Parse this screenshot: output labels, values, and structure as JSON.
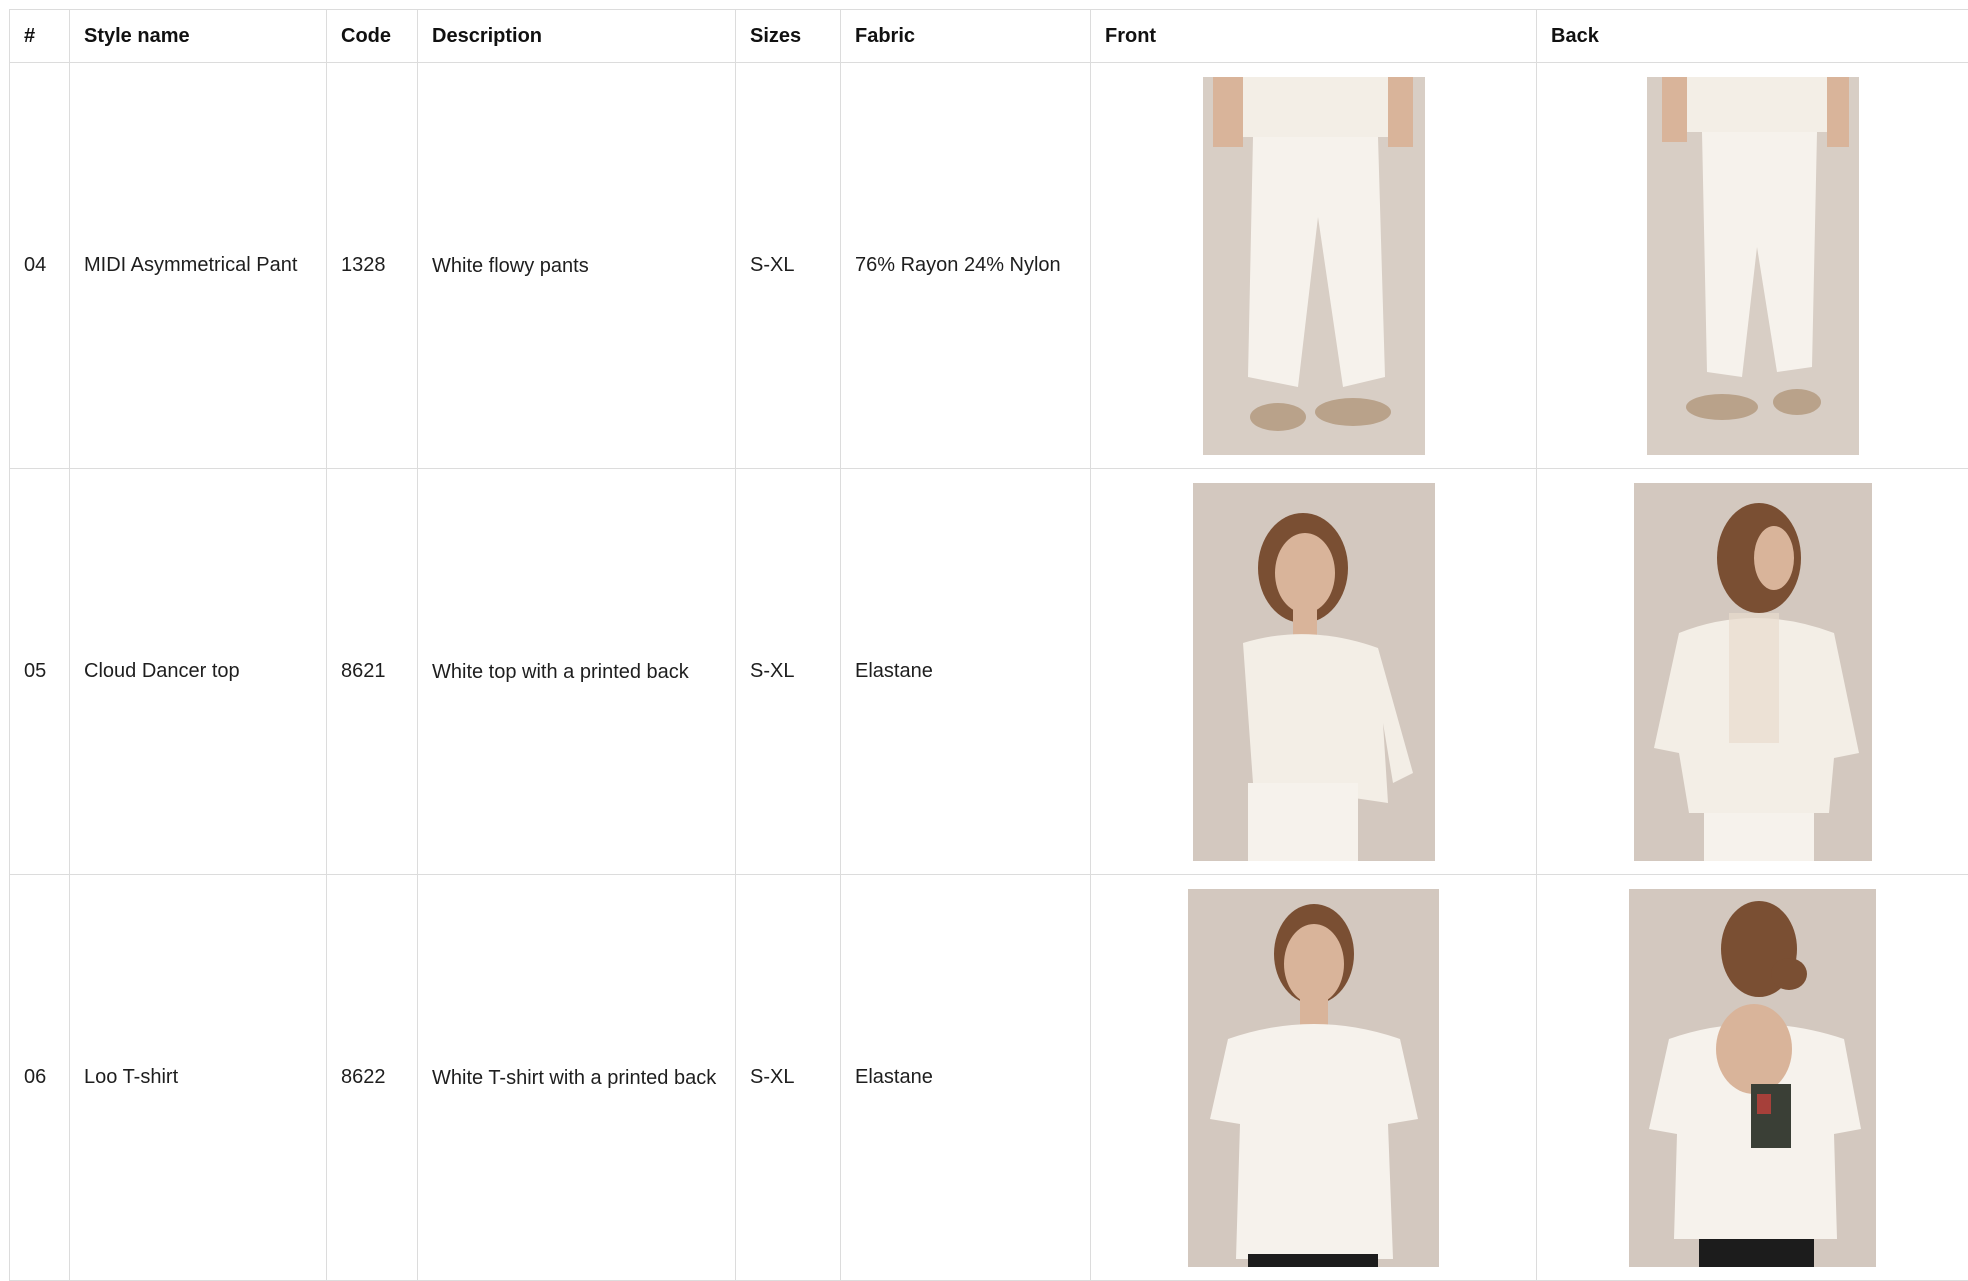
{
  "table": {
    "headers": {
      "num": "#",
      "style": "Style name",
      "code": "Code",
      "desc": "Description",
      "sizes": "Sizes",
      "fabric": "Fabric",
      "front": "Front",
      "back": "Back"
    },
    "rows": [
      {
        "num": "04",
        "style": "MIDI Asymmetrical Pant",
        "code": "1328",
        "desc": "White flowy pants",
        "sizes": "S-XL",
        "fabric": "76% Rayon 24% Nylon",
        "front_image": "model-front-white-pants-photo",
        "back_image": "model-back-white-pants-photo"
      },
      {
        "num": "05",
        "style": "Cloud Dancer top",
        "code": "8621",
        "desc": "White top with a printed back",
        "sizes": "S-XL",
        "fabric": "Elastane",
        "front_image": "model-front-white-top-photo",
        "back_image": "model-back-white-top-printed-photo"
      },
      {
        "num": "06",
        "style": "Loo T-shirt",
        "code": "8622",
        "desc": "White T-shirt with a printed back",
        "sizes": "S-XL",
        "fabric": "Elastane",
        "front_image": "model-front-white-tshirt-photo",
        "back_image": "model-back-white-tshirt-printed-photo"
      }
    ]
  },
  "colors": {
    "border": "#dcdcdc",
    "photo_background": "#d6ccc3",
    "garment": "#f3eee6",
    "skin": "#d9b49a",
    "hair": "#7a4f33"
  }
}
